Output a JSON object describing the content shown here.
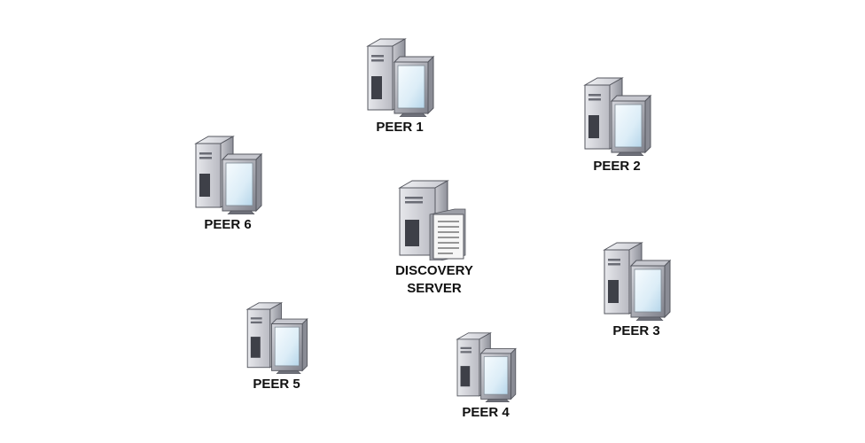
{
  "nodes": [
    {
      "label": "PEER 1"
    },
    {
      "label": "PEER 2"
    },
    {
      "label": "PEER 3"
    },
    {
      "label": "PEER 4"
    },
    {
      "label": "PEER 5"
    },
    {
      "label": "PEER 6"
    }
  ],
  "server": {
    "label_line1": "DISCOVERY",
    "label_line2": "SERVER"
  },
  "colors": {
    "tower_light": "#d9dadf",
    "tower_mid": "#a9aab3",
    "tower_dark": "#4a4c55",
    "screen_frame": "#aeb0b8",
    "screen_glass": "#e8f4fb",
    "screen_glass_shadow": "#b9d8ea",
    "document": "#f4f4f4"
  }
}
